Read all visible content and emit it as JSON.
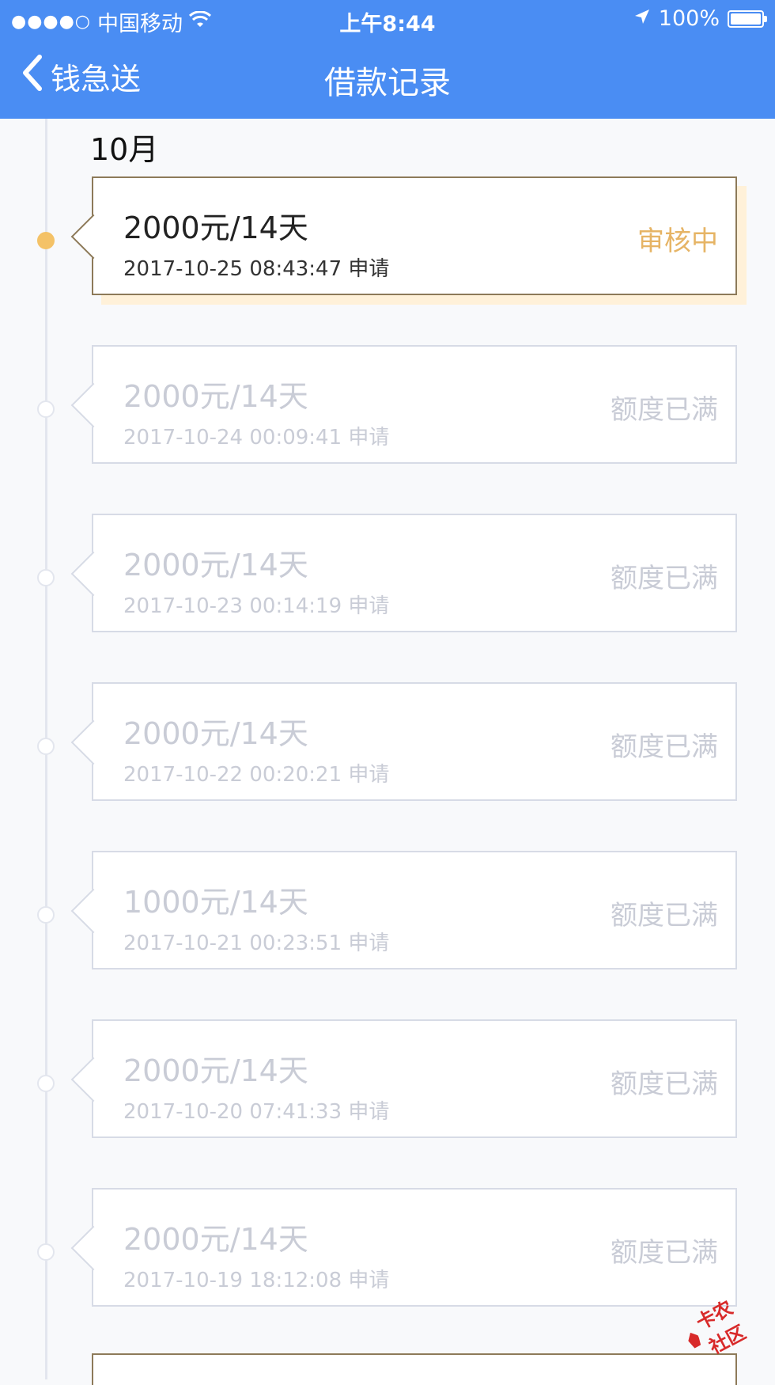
{
  "status_bar": {
    "signal": "●●●●○",
    "carrier": "中国移动",
    "time": "上午8:44",
    "battery": "100%"
  },
  "nav": {
    "back_label": "钱急送",
    "title": "借款记录"
  },
  "month": "10月",
  "records": [
    {
      "amount": "2000元/14天",
      "time": "2017-10-25 08:43:47 申请",
      "status": "审核中",
      "active": true
    },
    {
      "amount": "2000元/14天",
      "time": "2017-10-24 00:09:41 申请",
      "status": "额度已满",
      "active": false
    },
    {
      "amount": "2000元/14天",
      "time": "2017-10-23 00:14:19 申请",
      "status": "额度已满",
      "active": false
    },
    {
      "amount": "2000元/14天",
      "time": "2017-10-22 00:20:21 申请",
      "status": "额度已满",
      "active": false
    },
    {
      "amount": "1000元/14天",
      "time": "2017-10-21 00:23:51 申请",
      "status": "额度已满",
      "active": false
    },
    {
      "amount": "2000元/14天",
      "time": "2017-10-20 07:41:33 申请",
      "status": "额度已满",
      "active": false
    },
    {
      "amount": "2000元/14天",
      "time": "2017-10-19 18:12:08 申请",
      "status": "额度已满",
      "active": false
    }
  ],
  "watermark": "卡农社区",
  "colors": {
    "header": "#4a8df3",
    "active_status": "#e6b465",
    "active_dot": "#f4c267",
    "inactive_text": "#c9ccd6"
  },
  "icons": [
    "back-chevron-icon",
    "wifi-icon",
    "location-arrow-icon",
    "battery-icon",
    "timeline-dot-icon"
  ]
}
